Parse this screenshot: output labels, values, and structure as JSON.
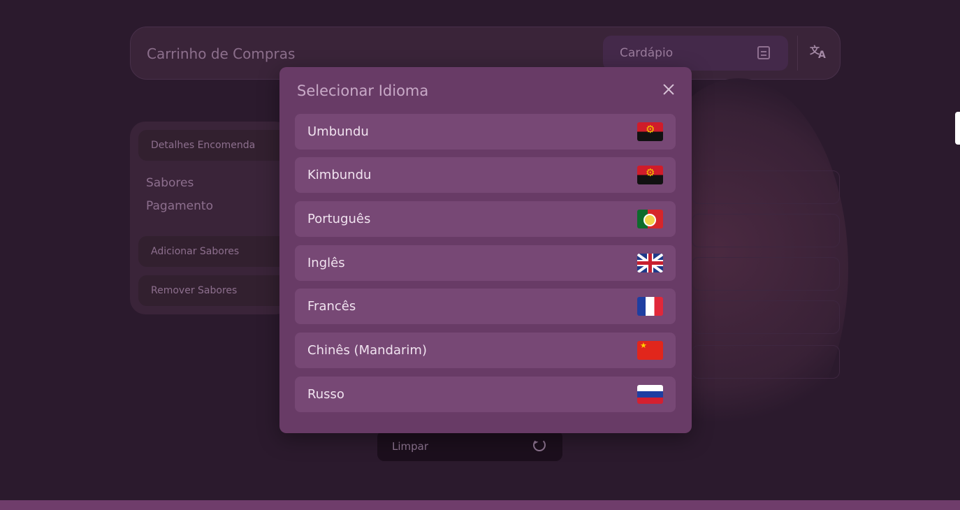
{
  "header": {
    "title": "Carrinho de Compras",
    "menu_label": "Cardápio",
    "translate_glyph_a": "文",
    "translate_glyph_b": "A"
  },
  "sidebar": {
    "details_label": "Detalhes Encomenda",
    "flavors_label": "Sabores",
    "payment_label": "Pagamento",
    "add_flavors_label": "Adicionar Sabores",
    "remove_flavors_label": "Remover Sabores"
  },
  "actions": {
    "clear_label": "Limpar"
  },
  "language_modal": {
    "title": "Selecionar Idioma",
    "languages": [
      {
        "label": "Umbundu",
        "flag": "angola"
      },
      {
        "label": "Kimbundu",
        "flag": "angola"
      },
      {
        "label": "Português",
        "flag": "portugal"
      },
      {
        "label": "Inglês",
        "flag": "united-kingdom"
      },
      {
        "label": "Francês",
        "flag": "france"
      },
      {
        "label": "Chinês (Mandarim)",
        "flag": "china"
      },
      {
        "label": "Russo",
        "flag": "russia"
      }
    ]
  },
  "colors": {
    "background": "#2b1a2d",
    "modal": "#683b66",
    "item": "#774875",
    "accent_bar": "#6f3d6b"
  }
}
